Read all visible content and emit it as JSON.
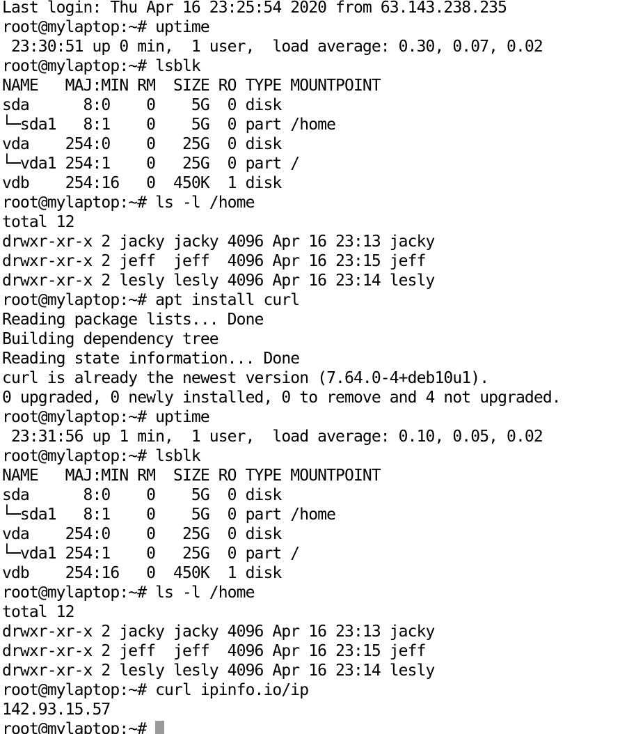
{
  "terminal": {
    "lines": [
      "Last login: Thu Apr 16 23:25:54 2020 from 63.143.238.235",
      "root@mylaptop:~# uptime",
      " 23:30:51 up 0 min,  1 user,  load average: 0.30, 0.07, 0.02",
      "root@mylaptop:~# lsblk",
      "NAME   MAJ:MIN RM  SIZE RO TYPE MOUNTPOINT",
      "sda      8:0    0    5G  0 disk",
      "└─sda1   8:1    0    5G  0 part /home",
      "vda    254:0    0   25G  0 disk",
      "└─vda1 254:1    0   25G  0 part /",
      "vdb    254:16   0  450K  1 disk",
      "root@mylaptop:~# ls -l /home",
      "total 12",
      "drwxr-xr-x 2 jacky jacky 4096 Apr 16 23:13 jacky",
      "drwxr-xr-x 2 jeff  jeff  4096 Apr 16 23:15 jeff",
      "drwxr-xr-x 2 lesly lesly 4096 Apr 16 23:14 lesly",
      "root@mylaptop:~# apt install curl",
      "Reading package lists... Done",
      "Building dependency tree",
      "Reading state information... Done",
      "curl is already the newest version (7.64.0-4+deb10u1).",
      "0 upgraded, 0 newly installed, 0 to remove and 4 not upgraded.",
      "root@mylaptop:~# uptime",
      " 23:31:56 up 1 min,  1 user,  load average: 0.10, 0.05, 0.02",
      "root@mylaptop:~# lsblk",
      "NAME   MAJ:MIN RM  SIZE RO TYPE MOUNTPOINT",
      "sda      8:0    0    5G  0 disk",
      "└─sda1   8:1    0    5G  0 part /home",
      "vda    254:0    0   25G  0 disk",
      "└─vda1 254:1    0   25G  0 part /",
      "vdb    254:16   0  450K  1 disk",
      "root@mylaptop:~# ls -l /home",
      "total 12",
      "drwxr-xr-x 2 jacky jacky 4096 Apr 16 23:13 jacky",
      "drwxr-xr-x 2 jeff  jeff  4096 Apr 16 23:15 jeff",
      "drwxr-xr-x 2 lesly lesly 4096 Apr 16 23:14 lesly",
      "root@mylaptop:~# curl ipinfo.io/ip",
      "142.93.15.57"
    ],
    "prompt": "root@mylaptop:~# ",
    "colors": {
      "background": "#ffffff",
      "text": "#000000",
      "cursor": "#9a9a9a"
    }
  }
}
